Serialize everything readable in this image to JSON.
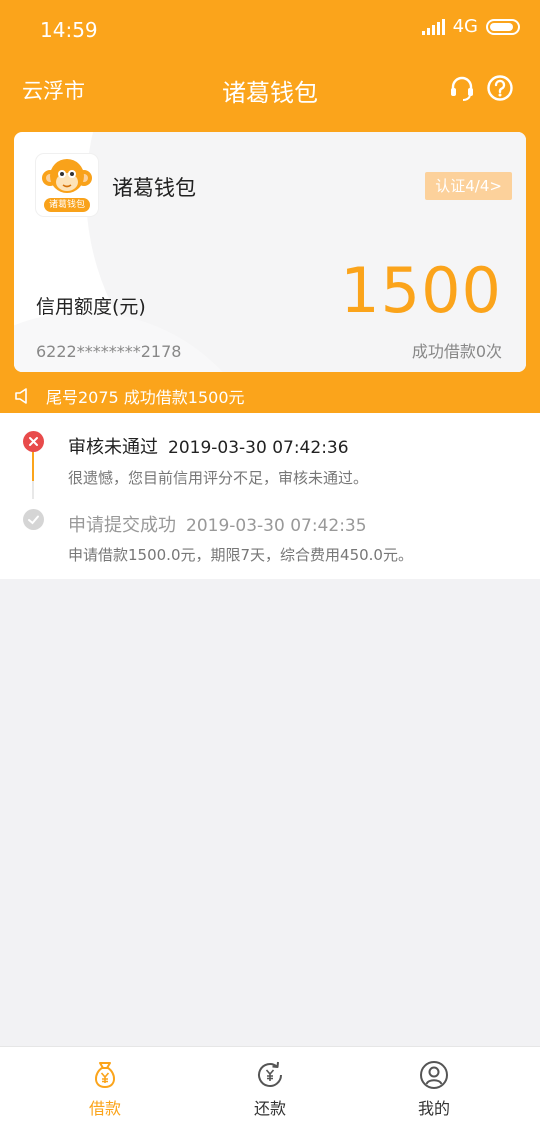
{
  "status_bar": {
    "time": "14:59",
    "network": "4G"
  },
  "nav": {
    "city": "云浮市",
    "title": "诸葛钱包"
  },
  "card": {
    "brand": "诸葛钱包",
    "logo_text": "诸葛钱包",
    "cert_label": "认证4/4",
    "cert_chevron": ">",
    "credit_label": "信用额度(元)",
    "amount": "1500",
    "card_number": "6222********2178",
    "success_count": "成功借款0次"
  },
  "notice": {
    "text": "尾号2075 成功借款1500元"
  },
  "timeline": [
    {
      "title": "审核未通过",
      "time": "2019-03-30 07:42:36",
      "desc": "很遗憾，您目前信用评分不足，审核未通过。",
      "status": "failed"
    },
    {
      "title": "申请提交成功",
      "time": "2019-03-30 07:42:35",
      "desc": "申请借款1500.0元，期限7天，综合费用450.0元。",
      "status": "done"
    }
  ],
  "tabs": [
    {
      "label": "借款",
      "icon": "money-bag-icon",
      "active": true
    },
    {
      "label": "还款",
      "icon": "repay-icon",
      "active": false
    },
    {
      "label": "我的",
      "icon": "user-icon",
      "active": false
    }
  ],
  "colors": {
    "primary": "#fba41b",
    "error": "#e84b4b",
    "cert_bg": "#fcd19b"
  }
}
